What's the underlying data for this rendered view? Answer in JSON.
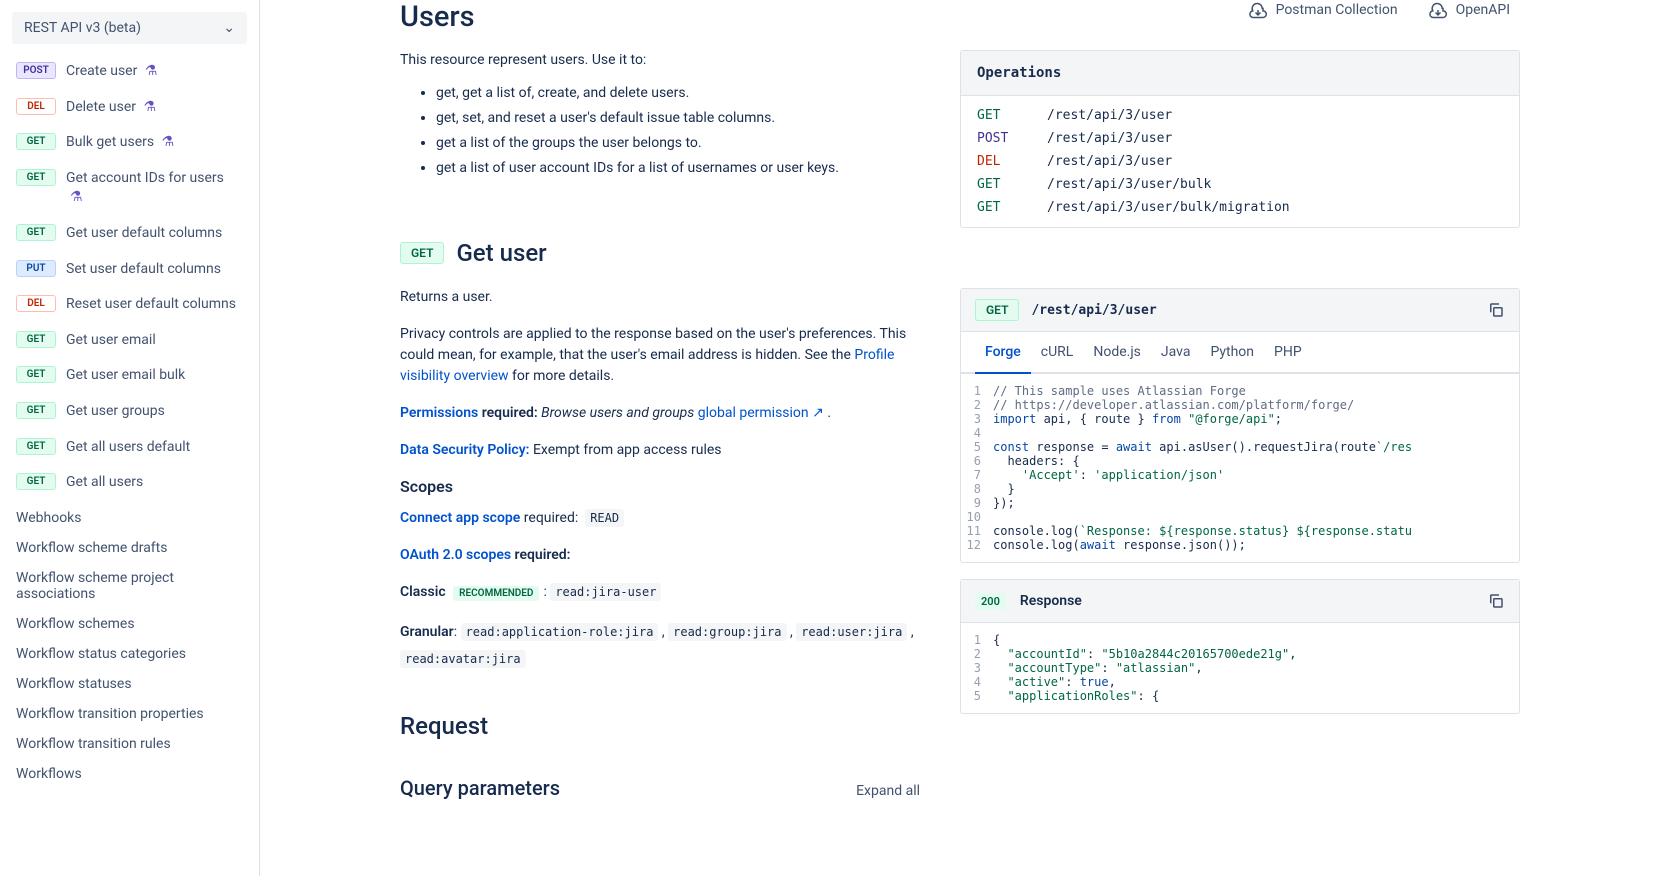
{
  "sidebar": {
    "dropdown": "REST API v3 (beta)",
    "items": [
      {
        "method": "POST",
        "label": "Create user",
        "flask": true
      },
      {
        "method": "DEL",
        "label": "Delete user",
        "flask": true
      },
      {
        "method": "GET",
        "label": "Bulk get users",
        "flask": true
      },
      {
        "method": "GET",
        "label": "Get account IDs for users",
        "flask": true
      },
      {
        "method": "GET",
        "label": "Get user default columns"
      },
      {
        "method": "PUT",
        "label": "Set user default columns"
      },
      {
        "method": "DEL",
        "label": "Reset user default columns"
      },
      {
        "method": "GET",
        "label": "Get user email"
      },
      {
        "method": "GET",
        "label": "Get user email bulk"
      },
      {
        "method": "GET",
        "label": "Get user groups"
      },
      {
        "method": "GET",
        "label": "Get all users default"
      },
      {
        "method": "GET",
        "label": "Get all users"
      }
    ],
    "plain": [
      "Webhooks",
      "Workflow scheme drafts",
      "Workflow scheme project associations",
      "Workflow schemes",
      "Workflow status categories",
      "Workflow statuses",
      "Workflow transition properties",
      "Workflow transition rules",
      "Workflows"
    ]
  },
  "top_actions": {
    "postman": "Postman Collection",
    "openapi": "OpenAPI"
  },
  "page": {
    "title": "Users",
    "intro": "This resource represent users. Use it to:",
    "bullets": [
      "get, get a list of, create, and delete users.",
      "get, set, and reset a user's default issue table columns.",
      "get a list of the groups the user belongs to.",
      "get a list of user account IDs for a list of usernames or user keys."
    ]
  },
  "ops": {
    "title": "Operations",
    "rows": [
      {
        "m": "GET",
        "cls": "get",
        "p": "/rest/api/3/user"
      },
      {
        "m": "POST",
        "cls": "post",
        "p": "/rest/api/3/user"
      },
      {
        "m": "DEL",
        "cls": "del",
        "p": "/rest/api/3/user"
      },
      {
        "m": "GET",
        "cls": "get",
        "p": "/rest/api/3/user/bulk"
      },
      {
        "m": "GET",
        "cls": "get",
        "p": "/rest/api/3/user/bulk/migration"
      }
    ]
  },
  "endpoint": {
    "method": "GET",
    "title": "Get user",
    "desc": "Returns a user.",
    "privacy_1": "Privacy controls are applied to the response based on the user's preferences. This could mean, for example, that the user's email address is hidden. See the ",
    "privacy_link": "Profile visibility overview",
    "privacy_2": " for more details.",
    "perm_link": "Permissions",
    "perm_text": " required:",
    "perm_em": " Browse users and groups ",
    "perm_gp": "global permission ↗",
    "dsp_link": "Data Security Policy:",
    "dsp_text": " Exempt from app access rules",
    "scopes_title": "Scopes",
    "connect_link": "Connect app scope",
    "connect_req": " required",
    "connect_code": "READ",
    "oauth_link": "OAuth 2.0 scopes",
    "oauth_req": " required:",
    "classic": "Classic",
    "rec": "RECOMMENDED",
    "classic_scope": "read:jira-user",
    "granular": "Granular",
    "granular_scopes": [
      "read:application-role:jira",
      "read:group:jira",
      "read:user:jira",
      "read:avatar:jira"
    ],
    "request": "Request",
    "query_params": "Query parameters",
    "expand": "Expand all"
  },
  "sample": {
    "method": "GET",
    "path": "/rest/api/3/user",
    "tabs": [
      "Forge",
      "cURL",
      "Node.js",
      "Java",
      "Python",
      "PHP"
    ]
  },
  "response": {
    "status": "200",
    "label": "Response"
  }
}
